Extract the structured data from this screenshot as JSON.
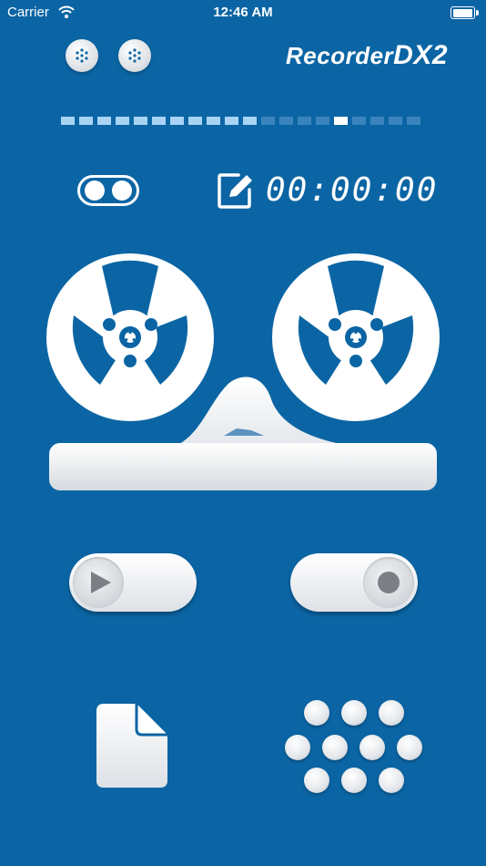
{
  "status_bar": {
    "carrier": "Carrier",
    "time": "12:46 AM",
    "battery_level": 1.0
  },
  "header": {
    "brand_main": "Recorder",
    "brand_suffix": "DX2"
  },
  "level_meter": {
    "segments": 20,
    "lit": 11,
    "peak_index": 15,
    "colors": {
      "lit": "#a9d3f5",
      "unlit": "#3a84bd",
      "peak": "#ffffff"
    }
  },
  "timer": {
    "value": "00:00:00"
  },
  "controls": {
    "play": "play-icon",
    "record": "record-icon"
  },
  "colors": {
    "background": "#0b65a4",
    "accent": "#ffffff"
  }
}
